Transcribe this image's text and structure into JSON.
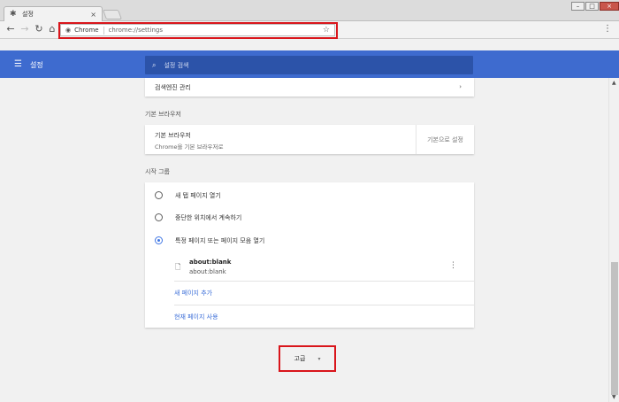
{
  "browser": {
    "tab_title": "설정",
    "tab_close": "×",
    "omnibox": {
      "site_label": "Chrome",
      "url": "chrome://settings"
    }
  },
  "header": {
    "title": "설정",
    "search_placeholder": "설정 검색"
  },
  "search_engine": {
    "manage_label": "검색엔진 관리"
  },
  "default_browser": {
    "heading": "기본 브라우저",
    "title": "기본 브라우저",
    "subtitle": "Chrome을 기본 브라우저로",
    "make_default_button": "기본으로 설정"
  },
  "on_startup": {
    "heading": "시작 그룹",
    "options": [
      {
        "label": "새 탭 페이지 열기",
        "checked": false
      },
      {
        "label": "중단한 위치에서 계속하기",
        "checked": false
      },
      {
        "label": "특정 페이지 또는 페이지 모음 열기",
        "checked": true
      }
    ],
    "pages": [
      {
        "title": "about:blank",
        "url": "about:blank"
      }
    ],
    "add_page_link": "새 페이지 추가",
    "use_current_pages_link": "현재 페이지 사용"
  },
  "advanced": {
    "label": "고급"
  },
  "colors": {
    "header_bg": "#3e6bcf",
    "search_bg": "#2c53a9",
    "link": "#3d6fd8",
    "highlight": "#d9151b"
  },
  "icons": {
    "tab_favicon": "gear-icon",
    "back": "back-arrow-icon",
    "forward": "forward-arrow-icon",
    "reload": "reload-icon",
    "home": "home-icon",
    "bookmark": "star-icon",
    "menu": "more-vert-icon",
    "hamburger": "hamburger-icon",
    "search": "search-icon",
    "page": "file-icon"
  }
}
